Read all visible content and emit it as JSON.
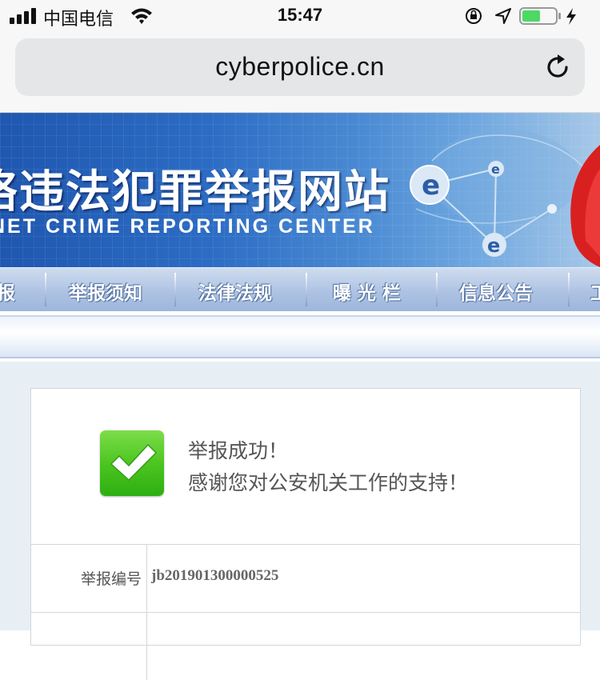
{
  "status_bar": {
    "carrier": "中国电信",
    "time": "15:47"
  },
  "browser": {
    "url": "cyberpolice.cn"
  },
  "banner": {
    "title": "络违法犯罪举报网站",
    "subtitle": "NET CRIME REPORTING CENTER"
  },
  "nav": {
    "items": [
      "报",
      "举报须知",
      "法律法规",
      "曝 光 栏",
      "信息公告",
      "工"
    ]
  },
  "result": {
    "success_line1": "举报成功！",
    "success_line2": "感谢您对公安机关工作的支持！",
    "report_id_label": "举报编号",
    "report_id_value": "jb201901300000525"
  },
  "colors": {
    "banner_blue": "#2c6cc4",
    "success_green": "#4cc620",
    "battery_green": "#4cd964"
  },
  "icons": [
    "signal-icon",
    "wifi-icon",
    "orientation-lock-icon",
    "location-arrow-icon",
    "battery-icon",
    "charging-icon",
    "reload-icon",
    "checkmark-icon"
  ]
}
